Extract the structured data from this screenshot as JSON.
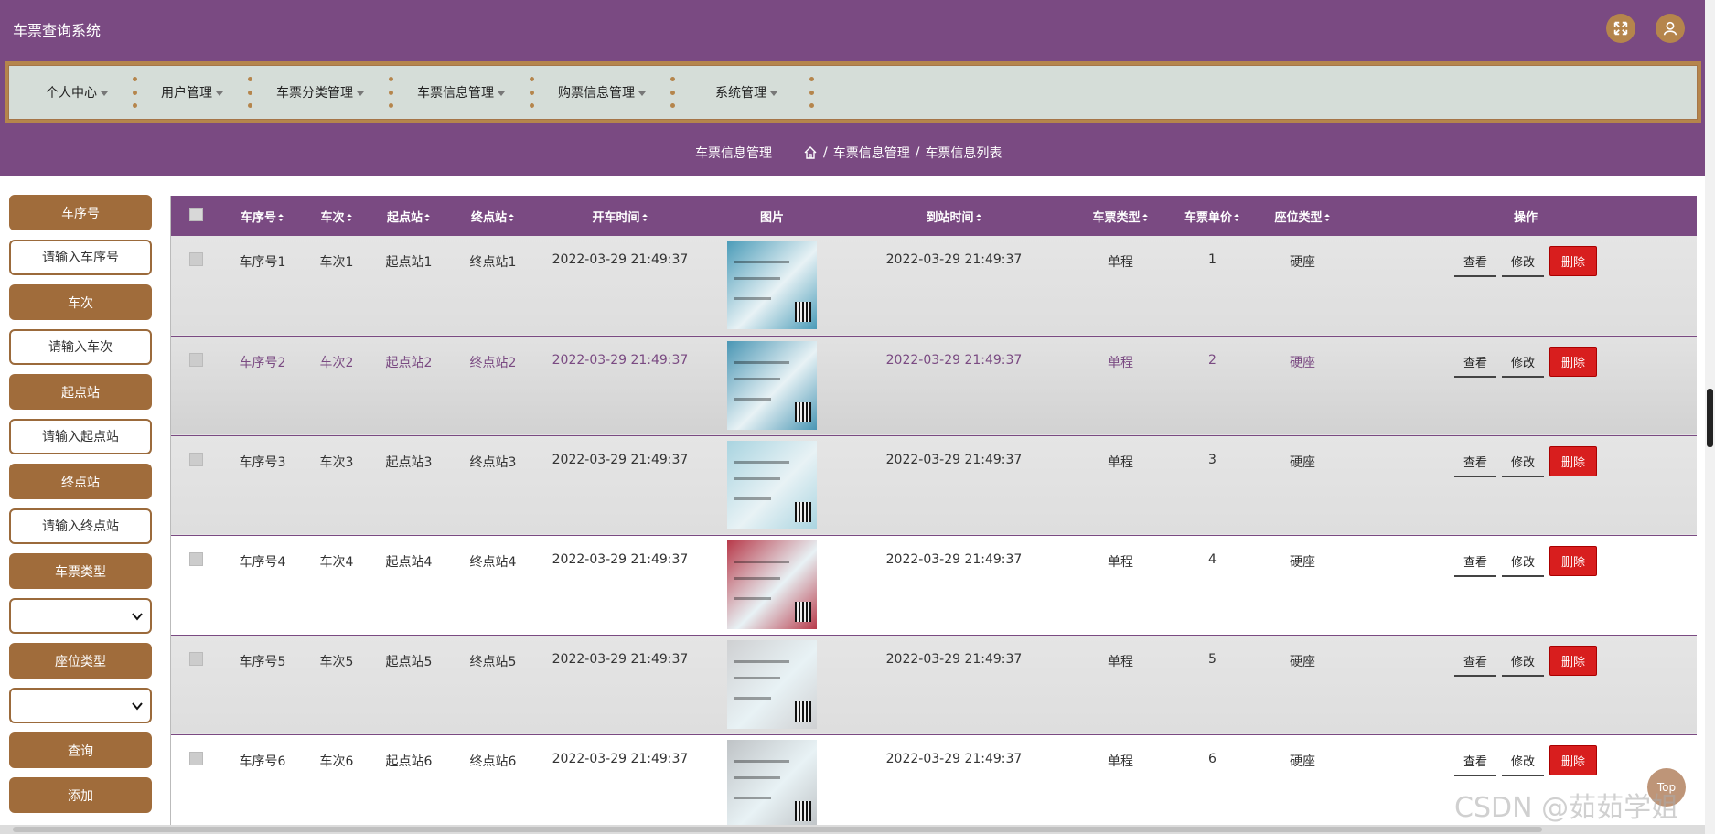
{
  "header": {
    "title": "车票查询系统",
    "fullscreen_icon": "fullscreen-icon",
    "user_icon": "user-icon"
  },
  "nav": {
    "items": [
      {
        "label": "个人中心"
      },
      {
        "label": "用户管理"
      },
      {
        "label": "车票分类管理"
      },
      {
        "label": "车票信息管理"
      },
      {
        "label": "购票信息管理"
      },
      {
        "label": "系统管理"
      }
    ]
  },
  "breadcrumb": {
    "page_title": "车票信息管理",
    "level1": "车票信息管理",
    "level2": "车票信息列表",
    "separator": "/"
  },
  "sidebar": {
    "ticket_no_label": "车序号",
    "ticket_no_placeholder": "请输入车序号",
    "train_label": "车次",
    "train_placeholder": "请输入车次",
    "start_label": "起点站",
    "start_placeholder": "请输入起点站",
    "end_label": "终点站",
    "end_placeholder": "请输入终点站",
    "ticket_type_label": "车票类型",
    "seat_type_label": "座位类型",
    "search_button": "查询",
    "add_button": "添加"
  },
  "table": {
    "columns": [
      "车序号",
      "车次",
      "起点站",
      "终点站",
      "开车时间",
      "图片",
      "到站时间",
      "车票类型",
      "车票单价",
      "座位类型",
      "操作"
    ],
    "actions": {
      "view": "查看",
      "edit": "修改",
      "delete": "删除"
    },
    "rows": [
      {
        "no": "车序号1",
        "train": "车次1",
        "start": "起点站1",
        "end": "终点站1",
        "depart": "2022-03-29 21:49:37",
        "arrive": "2022-03-29 21:49:37",
        "type": "单程",
        "price": "1",
        "seat": "硬座",
        "img_color": "#4a9bb8"
      },
      {
        "no": "车序号2",
        "train": "车次2",
        "start": "起点站2",
        "end": "终点站2",
        "depart": "2022-03-29 21:49:37",
        "arrive": "2022-03-29 21:49:37",
        "type": "单程",
        "price": "2",
        "seat": "硬座",
        "img_color": "#4a96b4"
      },
      {
        "no": "车序号3",
        "train": "车次3",
        "start": "起点站3",
        "end": "终点站3",
        "depart": "2022-03-29 21:49:37",
        "arrive": "2022-03-29 21:49:37",
        "type": "单程",
        "price": "3",
        "seat": "硬座",
        "img_color": "#a9d4e0"
      },
      {
        "no": "车序号4",
        "train": "车次4",
        "start": "起点站4",
        "end": "终点站4",
        "depart": "2022-03-29 21:49:37",
        "arrive": "2022-03-29 21:49:37",
        "type": "单程",
        "price": "4",
        "seat": "硬座",
        "img_color": "#b83a4a"
      },
      {
        "no": "车序号5",
        "train": "车次5",
        "start": "起点站5",
        "end": "终点站5",
        "depart": "2022-03-29 21:49:37",
        "arrive": "2022-03-29 21:49:37",
        "type": "单程",
        "price": "5",
        "seat": "硬座",
        "img_color": "#cfd0d2"
      },
      {
        "no": "车序号6",
        "train": "车次6",
        "start": "起点站6",
        "end": "终点站6",
        "depart": "2022-03-29 21:49:37",
        "arrive": "2022-03-29 21:49:37",
        "type": "单程",
        "price": "6",
        "seat": "硬座",
        "img_color": "#bfc3c6"
      }
    ]
  },
  "top_button": "Top",
  "watermark": "CSDN @茹茹学姐"
}
